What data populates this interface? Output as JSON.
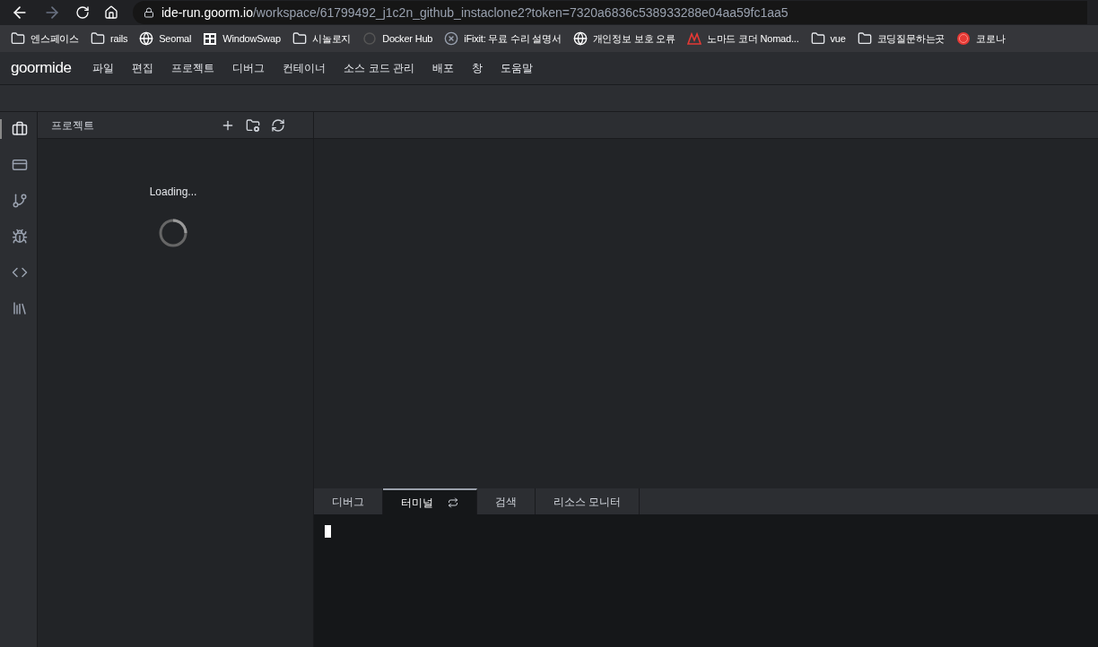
{
  "browser": {
    "url_host": "ide-run.goorm.io",
    "url_path": "/workspace/61799492_j1c2n_github_instaclone2?token=7320a6836c538933288e04aa59fc1aa5"
  },
  "bookmarks": [
    {
      "label": "엔스페이스",
      "kind": "folder"
    },
    {
      "label": "rails",
      "kind": "folder"
    },
    {
      "label": "Seomal",
      "kind": "globe"
    },
    {
      "label": "WindowSwap",
      "kind": "window"
    },
    {
      "label": "시놀로지",
      "kind": "folder"
    },
    {
      "label": "Docker Hub",
      "kind": "faint"
    },
    {
      "label": "iFixit: 무료 수리 설명서",
      "kind": "cross"
    },
    {
      "label": "개인정보 보호 오류",
      "kind": "globe"
    },
    {
      "label": "노마드 코더 Nomad...",
      "kind": "warning"
    },
    {
      "label": "vue",
      "kind": "folder"
    },
    {
      "label": "코딩질문하는곳",
      "kind": "folder"
    },
    {
      "label": "코로나",
      "kind": "record"
    }
  ],
  "app": {
    "logo": "goormide",
    "menu": [
      "파일",
      "편집",
      "프로젝트",
      "디버그",
      "컨테이너",
      "소스 코드 관리",
      "배포",
      "창",
      "도움말"
    ]
  },
  "activity_bar": [
    {
      "kind": "briefcase",
      "selected": true
    },
    {
      "kind": "panel",
      "selected": false
    },
    {
      "kind": "branch",
      "selected": false
    },
    {
      "kind": "bug",
      "selected": false
    },
    {
      "kind": "code",
      "selected": false
    },
    {
      "kind": "library",
      "selected": false
    }
  ],
  "project_panel": {
    "title": "프로젝트",
    "status": "Loading..."
  },
  "bottom_tabs": [
    {
      "label": "디버그",
      "selected": false,
      "sync": false
    },
    {
      "label": "터미널",
      "selected": true,
      "sync": true
    },
    {
      "label": "검색",
      "selected": false,
      "sync": false
    },
    {
      "label": "리소스 모니터",
      "selected": false,
      "sync": false
    }
  ]
}
